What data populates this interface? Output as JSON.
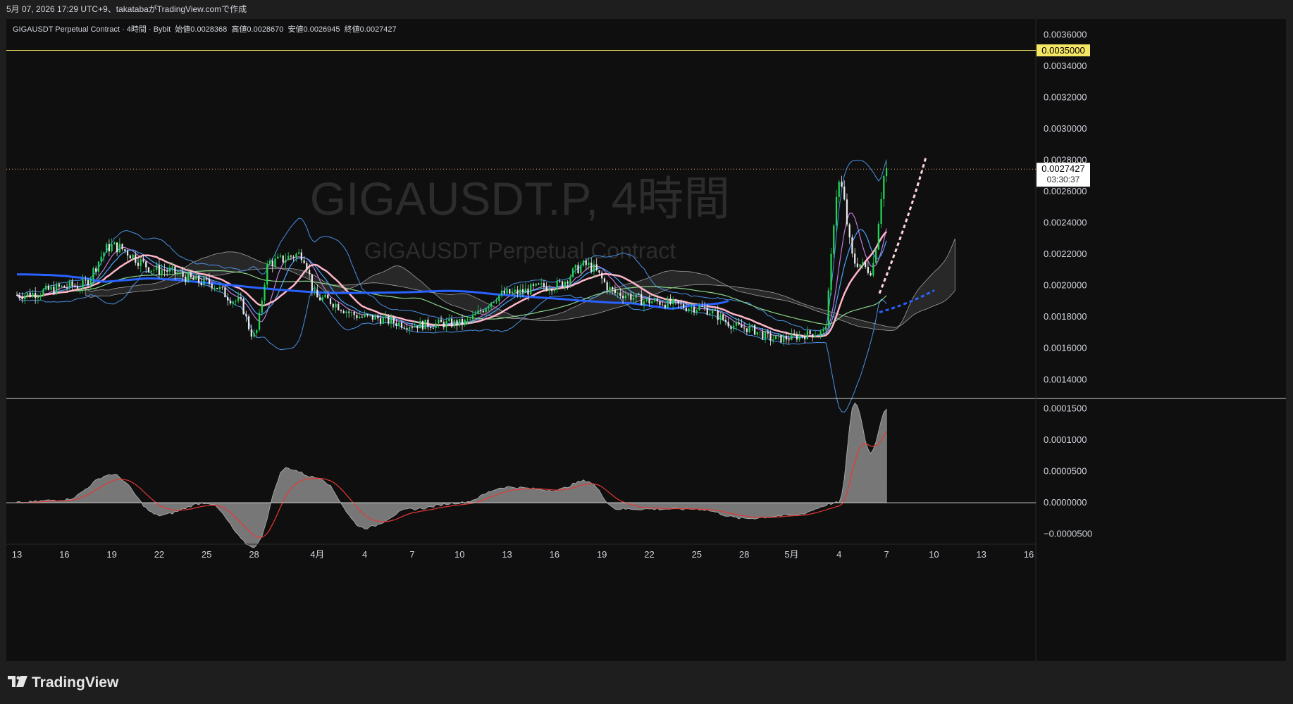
{
  "header": {
    "caption": "5月 07, 2026 17:29 UTC+9、takatabaがTradingView.comで作成"
  },
  "legend": {
    "symbol": "GIGAUSDT Perpetual Contract · 4時間 · Bybit",
    "open_label": "始値",
    "open": "0.0028368",
    "high_label": "高値",
    "high": "0.0028670",
    "low_label": "安値",
    "low": "0.0026945",
    "close_label": "終値",
    "close": "0.0027427"
  },
  "watermark": {
    "title": "GIGAUSDT.P, 4時間",
    "subtitle": "GIGAUSDT Perpetual Contract"
  },
  "price_tags": {
    "alert_level": "0.0035000",
    "last_price": "0.0027427",
    "countdown": "03:30:37"
  },
  "brand": {
    "name": "TradingView"
  },
  "colors": {
    "background": "#0f0f0f",
    "bull": "#26a69a",
    "bear": "#ef5350",
    "ma_fast": "#ffb6c8",
    "ma_slow": "#2962ff",
    "bollinger": "#4a90e2",
    "ichimoku": "#9e9e9e",
    "alert_line": "#f5e663"
  },
  "chart_data": [
    {
      "type": "candlestick",
      "title": "GIGAUSDT.P, 4時間",
      "y_ticks": [
        "0.0036000",
        "0.0034000",
        "0.0032000",
        "0.0030000",
        "0.0028000",
        "0.0026000",
        "0.0024000",
        "0.0022000",
        "0.0020000",
        "0.0018000",
        "0.0016000",
        "0.0014000"
      ],
      "ylim": [
        0.00128,
        0.0037
      ],
      "x_ticks": [
        "13",
        "16",
        "19",
        "22",
        "25",
        "28",
        "4月",
        "4",
        "7",
        "10",
        "13",
        "16",
        "19",
        "22",
        "25",
        "28",
        "5月",
        "4",
        "7",
        "10",
        "13",
        "16"
      ],
      "xlim": [
        "3月13",
        "5月16"
      ],
      "price_path_keypoints": [
        [
          "3月13",
          0.00194
        ],
        [
          "3月17",
          0.002
        ],
        [
          "3月19",
          0.00225
        ],
        [
          "3月22",
          0.0021
        ],
        [
          "3月25",
          0.00202
        ],
        [
          "3月27",
          0.0019
        ],
        [
          "3月28",
          0.00168
        ],
        [
          "3月29",
          0.00215
        ],
        [
          "3月31",
          0.0022
        ],
        [
          "4月1",
          0.00192
        ],
        [
          "4月4",
          0.0018
        ],
        [
          "4月7",
          0.00175
        ],
        [
          "4月10",
          0.00176
        ],
        [
          "4月13",
          0.00195
        ],
        [
          "4月16",
          0.002
        ],
        [
          "4月18",
          0.00213
        ],
        [
          "4月20",
          0.00195
        ],
        [
          "4月22",
          0.0019
        ],
        [
          "4月25",
          0.00186
        ],
        [
          "4月28",
          0.00173
        ],
        [
          "4月30",
          0.00166
        ],
        [
          "5月3",
          0.0017
        ],
        [
          "5月4",
          0.00265
        ],
        [
          "5月5",
          0.00215
        ],
        [
          "5月6",
          0.0021
        ],
        [
          "5月7",
          0.00274
        ]
      ],
      "alert_level": 0.0035,
      "last_price": 0.0027427,
      "overlays": [
        "moving averages",
        "bollinger bands",
        "ichimoku cloud"
      ],
      "grid": false
    },
    {
      "type": "area",
      "title": "",
      "y_ticks": [
        "0.0001500",
        "0.0001000",
        "0.0000500",
        "0.0000000",
        "−0.0000500"
      ],
      "ylim": [
        -6.6e-05,
        0.000165
      ],
      "series_keypoints": [
        [
          "3月13",
          0.0
        ],
        [
          "3月16",
          5e-06
        ],
        [
          "3月19",
          4.5e-05
        ],
        [
          "3月22",
          -2e-05
        ],
        [
          "3月25",
          0.0
        ],
        [
          "3月28",
          -7e-05
        ],
        [
          "3月30",
          5.5e-05
        ],
        [
          "4月1",
          4e-05
        ],
        [
          "4月4",
          -4e-05
        ],
        [
          "4月7",
          -1e-05
        ],
        [
          "4月10",
          0.0
        ],
        [
          "4月13",
          2.5e-05
        ],
        [
          "4月16",
          2e-05
        ],
        [
          "4月18",
          3.5e-05
        ],
        [
          "4月20",
          -1e-05
        ],
        [
          "4月25",
          -1e-05
        ],
        [
          "4月28",
          -2.5e-05
        ],
        [
          "5月1",
          -2e-05
        ],
        [
          "5月4",
          0.0
        ],
        [
          "5月5",
          0.00016
        ],
        [
          "5月6",
          8e-05
        ],
        [
          "5月7",
          0.00015
        ]
      ]
    }
  ]
}
